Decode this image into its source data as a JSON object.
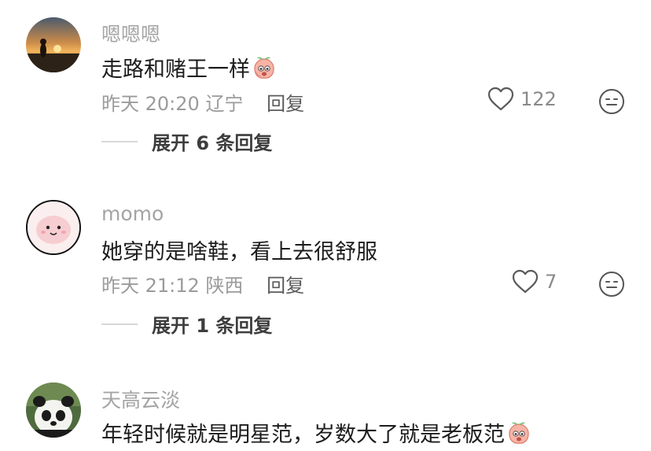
{
  "comments": [
    {
      "username": "嗯嗯嗯",
      "text": "走路和赌王一样",
      "time": "昨天 20:20",
      "location": "辽宁",
      "reply_label": "回复",
      "likes": "122",
      "expand_label": "展开 6 条回复",
      "sticker": "peach-emoji-icon"
    },
    {
      "username": "momo",
      "text": "她穿的是啥鞋，看上去很舒服",
      "time": "昨天 21:12",
      "location": "陕西",
      "reply_label": "回复",
      "likes": "7",
      "expand_label": "展开 1 条回复"
    },
    {
      "username": "天高云淡",
      "text": "年轻时候就是明星范，岁数大了就是老板范",
      "sticker": "peach-emoji-icon"
    }
  ],
  "colors": {
    "username": "#a4a4a4",
    "text": "#1c1c1c",
    "meta": "#9b9b9b",
    "reply": "#5a5a5a",
    "expand": "#3d3d3d"
  }
}
